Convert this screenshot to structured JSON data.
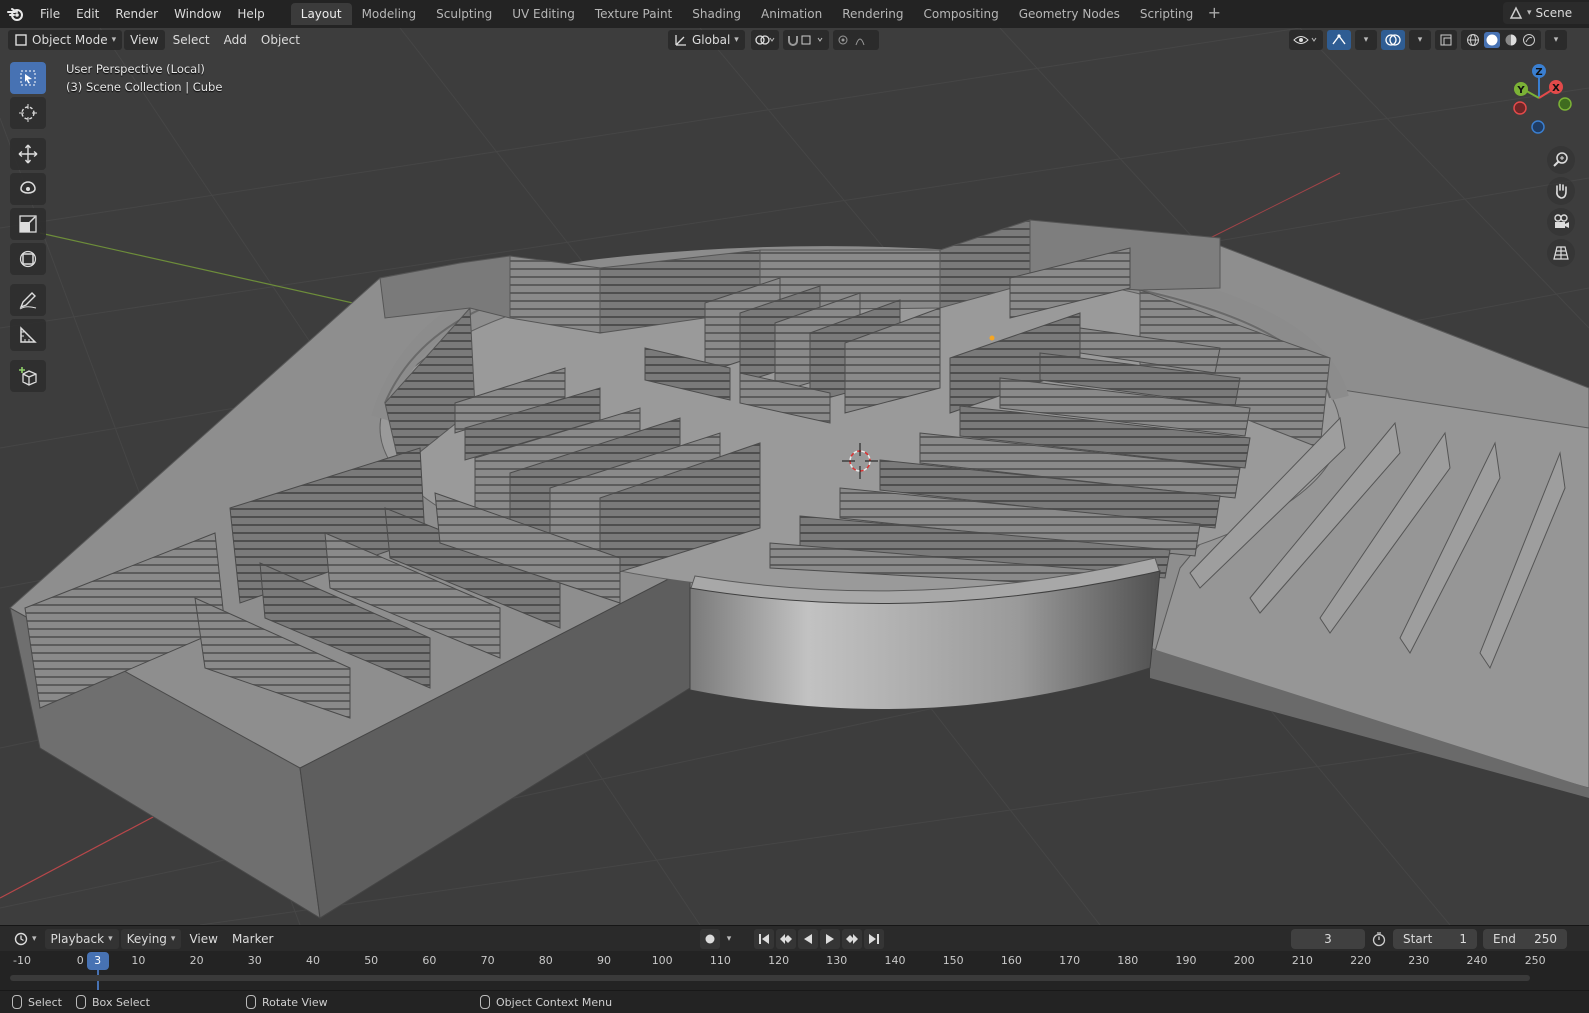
{
  "topbar": {
    "menus": [
      "File",
      "Edit",
      "Render",
      "Window",
      "Help"
    ],
    "workspaces": [
      "Layout",
      "Modeling",
      "Sculpting",
      "UV Editing",
      "Texture Paint",
      "Shading",
      "Animation",
      "Rendering",
      "Compositing",
      "Geometry Nodes",
      "Scripting"
    ],
    "active_workspace": "Layout",
    "scene_label": "Scene"
  },
  "viewport": {
    "mode_label": "Object Mode",
    "menus": [
      "View",
      "Select",
      "Add",
      "Object"
    ],
    "transform_orientation": "Global",
    "info_line1": "User Perspective (Local)",
    "info_line2": "(3) Scene Collection | Cube",
    "gizmo_axes": {
      "x": "X",
      "y": "Y",
      "z": "Z"
    },
    "colors": {
      "background": "#3d3d3d",
      "x_axis": "#e34a4a",
      "y_axis": "#7bb236",
      "z_axis": "#3a7fd1",
      "active_tool": "#4772b3"
    }
  },
  "timeline": {
    "menus": [
      "Playback",
      "Keying",
      "View",
      "Marker"
    ],
    "current_frame": "3",
    "start_label": "Start",
    "start_value": "1",
    "end_label": "End",
    "end_value": "250",
    "ticks": [
      "-10",
      "0",
      "10",
      "20",
      "30",
      "40",
      "50",
      "60",
      "70",
      "80",
      "90",
      "100",
      "110",
      "120",
      "130",
      "140",
      "150",
      "160",
      "170",
      "180",
      "190",
      "200",
      "210",
      "220",
      "230",
      "240",
      "250"
    ]
  },
  "statusbar": {
    "select": "Select",
    "box_select": "Box Select",
    "rotate_view": "Rotate View",
    "context_menu": "Object Context Menu"
  }
}
